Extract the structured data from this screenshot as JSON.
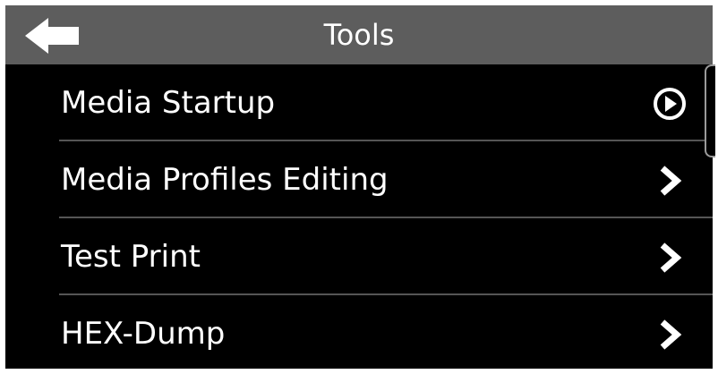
{
  "header": {
    "title": "Tools",
    "back_icon": "back-arrow-icon"
  },
  "menu": {
    "items": [
      {
        "label": "Media Startup",
        "icon": "play-circle-icon"
      },
      {
        "label": "Media Profiles Editing",
        "icon": "chevron-right-icon"
      },
      {
        "label": "Test Print",
        "icon": "chevron-right-icon"
      },
      {
        "label": "HEX-Dump",
        "icon": "chevron-right-icon"
      }
    ]
  },
  "colors": {
    "titlebar": "#5d5d5d",
    "background": "#000000",
    "text": "#ffffff",
    "divider": "#555555"
  }
}
